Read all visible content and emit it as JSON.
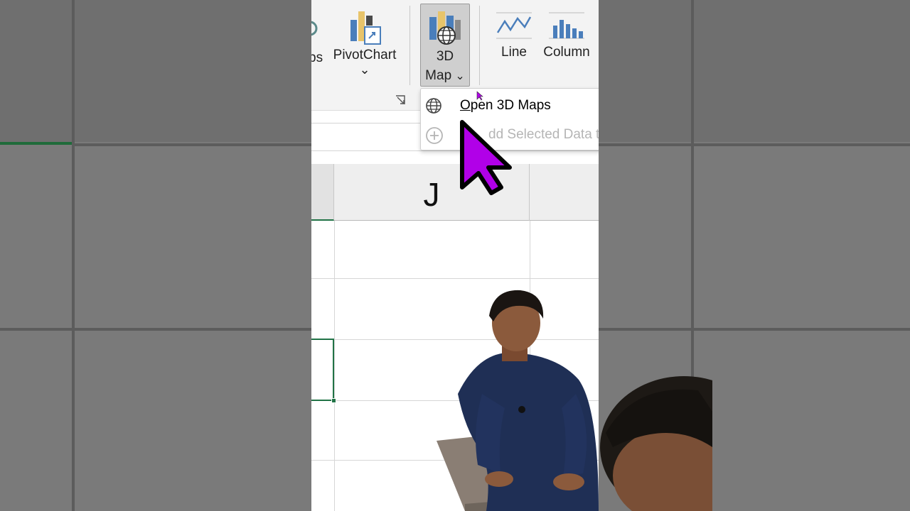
{
  "ribbon": {
    "maps_partial_label": "ps",
    "pivotchart_label": "PivotChart",
    "pivotchart_chevron": "⌄",
    "map3d_line1": "3D",
    "map3d_line2": "Map",
    "map3d_chevron": "⌄",
    "line_label": "Line",
    "column_label": "Column"
  },
  "sheet": {
    "column_header": "J"
  },
  "dropdown": {
    "items": [
      {
        "prefix_underlined": "O",
        "label_rest": "pen 3D Maps",
        "icon": "globe-icon",
        "enabled": true
      },
      {
        "label": "Add Selected Data to",
        "visible_label": "dd Selected Data to",
        "icon": "add-circle-icon",
        "enabled": false
      }
    ]
  },
  "colors": {
    "accent_green": "#217346",
    "cursor_purple": "#b100e8",
    "chart_blue": "#4a7ebb",
    "chart_gold": "#e8c46a"
  }
}
